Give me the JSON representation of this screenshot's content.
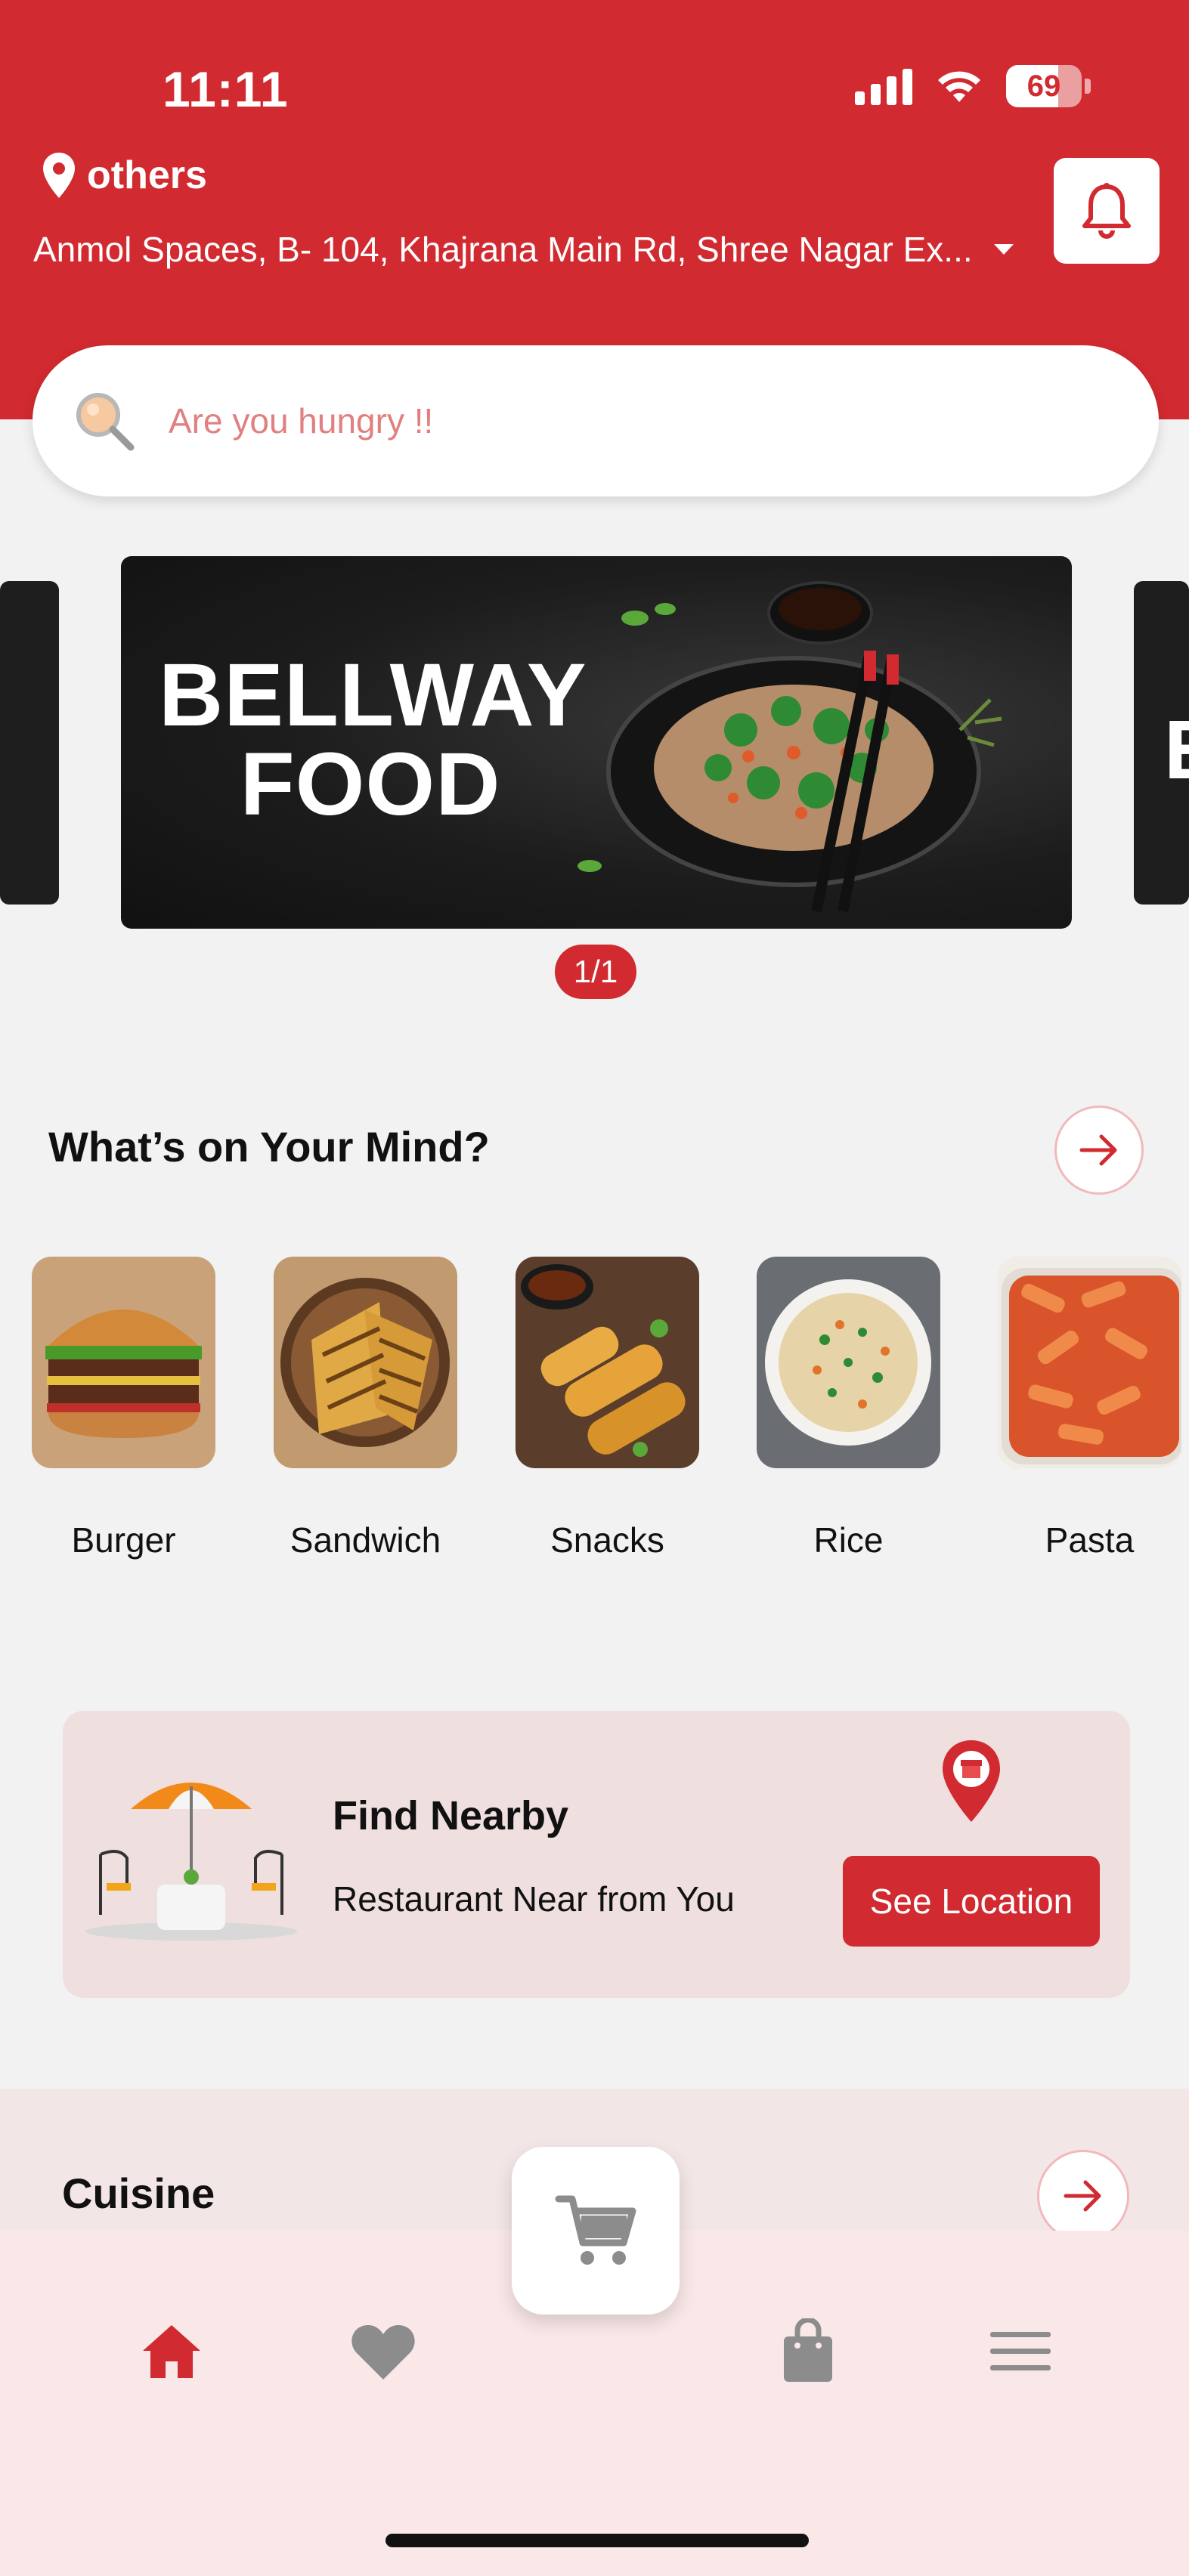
{
  "status_bar": {
    "time": "11:11",
    "battery": "69",
    "battery_level": 0.69
  },
  "header": {
    "location_name": "others",
    "address": "Anmol Spaces, B- 104, Khajrana Main Rd, Shree Nagar Ex...",
    "accent_color": "#d12a30"
  },
  "search": {
    "placeholder": "Are you hungry !!"
  },
  "banner": {
    "title_line1": "BELLWAY",
    "title_line2": "FOOD",
    "pager": "1/1"
  },
  "mind_section": {
    "title": "What’s on Your Mind?"
  },
  "categories": [
    {
      "label": "Burger"
    },
    {
      "label": "Sandwich"
    },
    {
      "label": "Snacks"
    },
    {
      "label": "Rice"
    },
    {
      "label": "Pasta"
    }
  ],
  "nearby": {
    "title": "Find Nearby",
    "subtitle": "Restaurant Near from You",
    "button_label": "See Location"
  },
  "cuisine_section": {
    "title": "Cuisine"
  },
  "bottom_nav": {
    "items": [
      {
        "icon": "home-icon",
        "active": true
      },
      {
        "icon": "heart-icon",
        "active": false
      },
      {
        "icon": "cart-icon",
        "active": false
      },
      {
        "icon": "bag-icon",
        "active": false
      },
      {
        "icon": "menu-icon",
        "active": false
      }
    ]
  }
}
